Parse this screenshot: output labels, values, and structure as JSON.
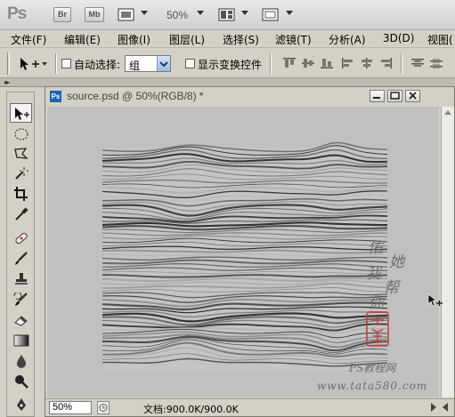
{
  "app": {
    "logo": "Ps",
    "bar_buttons": [
      "Br",
      "Mb"
    ],
    "zoom": "50%"
  },
  "menu": {
    "items": [
      "文件(F)",
      "编辑(E)",
      "图像(I)",
      "图层(L)",
      "选择(S)",
      "滤镜(T)",
      "分析(A)",
      "3D(D)",
      "视图("
    ]
  },
  "options": {
    "auto_select_label": "自动选择:",
    "auto_select_value": "组",
    "show_transform_label": "显示变换控件"
  },
  "document": {
    "title": "source.psd @ 50%(RGB/8) *",
    "file_icon_label": "Ps",
    "zoom_value": "50%",
    "doc_size": "文档:900.0K/900.0K"
  },
  "watermark": {
    "chars": [
      "佑",
      "她",
      "我",
      "帮",
      "你"
    ],
    "brand": "PS教程网",
    "url": "www.tata580.com",
    "seal_color": "#c23a3a"
  },
  "colors": {
    "chrome": "#d4d0c8",
    "canvas_bg": "#c0c0c0",
    "image_bg": "#c4c4c4",
    "stripe_dark": "#3c3c3c",
    "accent_blue": "#1a63b4"
  },
  "tools": [
    "move-tool-icon",
    "elliptical-marquee-icon",
    "polygonal-lasso-icon",
    "magic-wand-icon",
    "crop-icon",
    "eyedropper-icon",
    "spot-healing-icon",
    "brush-icon",
    "clone-stamp-icon",
    "history-brush-icon",
    "eraser-icon",
    "gradient-icon",
    "blur-icon",
    "dodge-icon",
    "pen-icon"
  ]
}
